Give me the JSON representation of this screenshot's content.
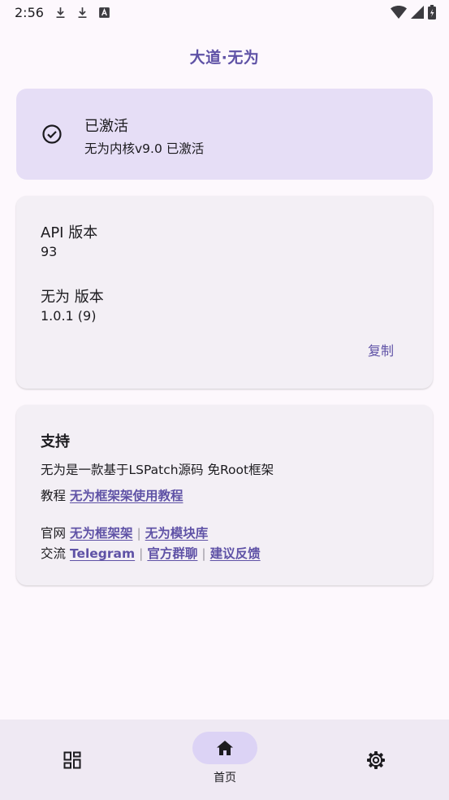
{
  "status_bar": {
    "time": "2:56"
  },
  "app": {
    "title": "大道·无为"
  },
  "status_card": {
    "title": "已激活",
    "subtitle": "无为内核v9.0 已激活"
  },
  "info_card": {
    "api_label": "API 版本",
    "api_value": "93",
    "version_label": "无为 版本",
    "version_value": "1.0.1 (9)",
    "copy_label": "复制"
  },
  "support_card": {
    "title": "支持",
    "description": "无为是一款基于LSPatch源码 免Root框架",
    "tutorial_prefix": "教程",
    "tutorial_link": "无为框架架使用教程",
    "website_prefix": "官网",
    "website_link_1": "无为框架架",
    "website_link_2": "无为模块库",
    "community_prefix": "交流",
    "community_link_1": "Telegram",
    "community_link_2": "官方群聊",
    "community_link_3": "建议反馈",
    "separator": "|"
  },
  "bottom_nav": {
    "items": [
      {
        "icon": "apps-grid-icon",
        "label": ""
      },
      {
        "icon": "home-icon",
        "label": "首页",
        "selected": true
      },
      {
        "icon": "gear-icon",
        "label": ""
      }
    ]
  },
  "colors": {
    "accent": "#5f52a6",
    "status_card_bg": "#e6def6",
    "card_bg": "#f3eff5",
    "page_bg": "#fdf8fd",
    "nav_bg": "#efe9f3",
    "nav_indicator": "#dcd3f5"
  }
}
